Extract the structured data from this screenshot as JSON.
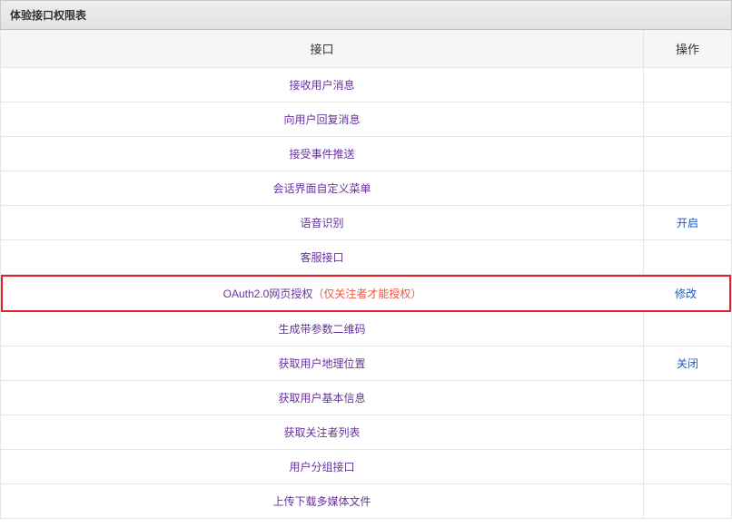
{
  "panel": {
    "title": "体验接口权限表"
  },
  "table": {
    "headers": {
      "interface": "接口",
      "action": "操作"
    },
    "rows": [
      {
        "label": "接收用户消息",
        "annotation": "",
        "action": "",
        "highlighted": false
      },
      {
        "label": "向用户回复消息",
        "annotation": "",
        "action": "",
        "highlighted": false
      },
      {
        "label": "接受事件推送",
        "annotation": "",
        "action": "",
        "highlighted": false
      },
      {
        "label": "会话界面自定义菜单",
        "annotation": "",
        "action": "",
        "highlighted": false
      },
      {
        "label": "语音识别",
        "annotation": "",
        "action": "开启",
        "highlighted": false
      },
      {
        "label": "客服接口",
        "annotation": "",
        "action": "",
        "highlighted": false
      },
      {
        "label": "OAuth2.0网页授权",
        "annotation": "（仅关注者才能授权）",
        "action": "修改",
        "highlighted": true
      },
      {
        "label": "生成带参数二维码",
        "annotation": "",
        "action": "",
        "highlighted": false
      },
      {
        "label": "获取用户地理位置",
        "annotation": "",
        "action": "关闭",
        "highlighted": false
      },
      {
        "label": "获取用户基本信息",
        "annotation": "",
        "action": "",
        "highlighted": false
      },
      {
        "label": "获取关注者列表",
        "annotation": "",
        "action": "",
        "highlighted": false
      },
      {
        "label": "用户分组接口",
        "annotation": "",
        "action": "",
        "highlighted": false
      },
      {
        "label": "上传下载多媒体文件",
        "annotation": "",
        "action": "",
        "highlighted": false
      }
    ]
  }
}
